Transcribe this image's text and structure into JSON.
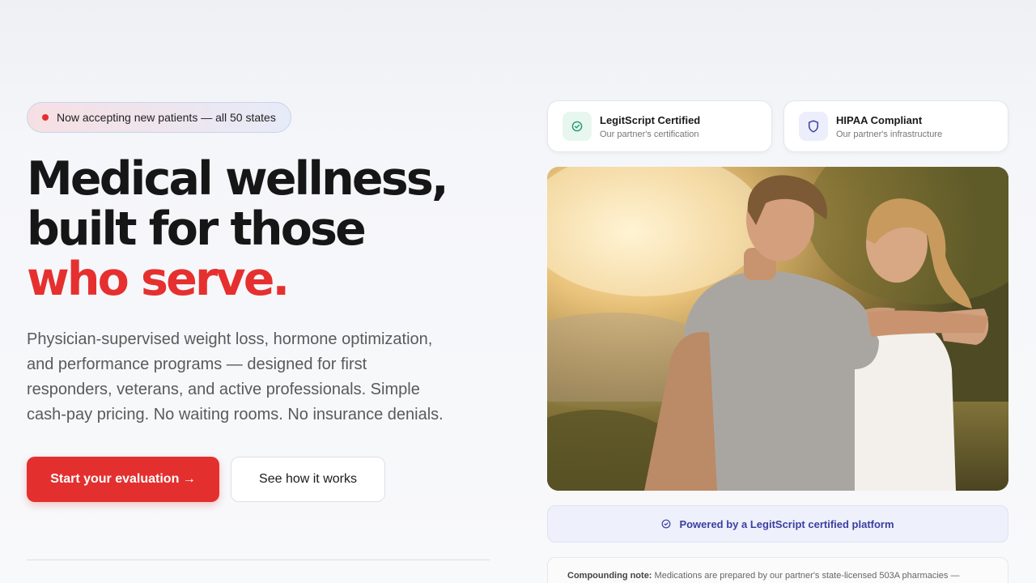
{
  "hero": {
    "badge": "Now accepting new patients — all 50 states",
    "headline_line1": "Medical wellness,",
    "headline_line2": "built for those",
    "headline_accent": "who serve.",
    "subtext": "Physician-supervised weight loss, hormone optimization, and performance programs — designed for first responders, veterans, and active professionals. Simple cash-pay pricing. No waiting rooms. No insurance denials.",
    "cta_primary": "Start your evaluation →",
    "cta_secondary": "See how it works"
  },
  "trust": [
    {
      "title": "LegitScript Certified",
      "subtitle": "Our partner's certification",
      "icon": "check-circle-icon"
    },
    {
      "title": "HIPAA Compliant",
      "subtitle": "Our partner's infrastructure",
      "icon": "shield-icon"
    }
  ],
  "powered_by": "Powered by a LegitScript certified platform",
  "note": {
    "label": "Compounding note:",
    "text": "Medications are prepared by our partner's state-licensed 503A pharmacies —"
  },
  "colors": {
    "accent": "#e5302f",
    "badge_dot": "#e5302f",
    "powered_text": "#3b3fa0"
  }
}
